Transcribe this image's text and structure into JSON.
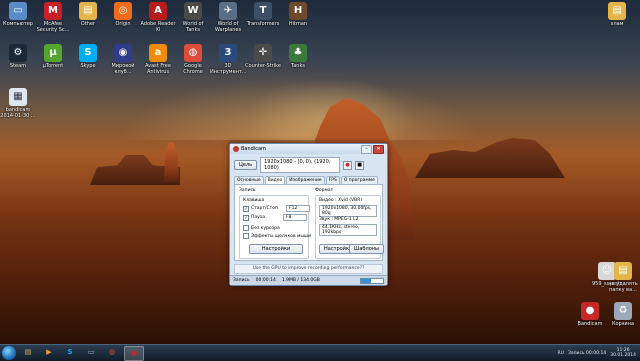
{
  "desktop_icons": [
    {
      "name": "computer",
      "label": "Компьютер",
      "color": "#5b8cc8",
      "glyph": "▭"
    },
    {
      "name": "mcafee",
      "label": "McAfee Security Sc...",
      "color": "#c8202a",
      "glyph": "M"
    },
    {
      "name": "other",
      "label": "Other",
      "color": "#e2b54a",
      "glyph": "▤"
    },
    {
      "name": "origin",
      "label": "Origin",
      "color": "#f26b1d",
      "glyph": "◎"
    },
    {
      "name": "acrobat",
      "label": "Adobe Reader XI",
      "color": "#b71c1c",
      "glyph": "A"
    },
    {
      "name": "wot",
      "label": "World of Tanks",
      "color": "#4a4a4a",
      "glyph": "W"
    },
    {
      "name": "wot-warplanes",
      "label": "World of Warplanes",
      "color": "#5a6f85",
      "glyph": "✈"
    },
    {
      "name": "transformers",
      "label": "Transformers",
      "color": "#3c4f66",
      "glyph": "T"
    },
    {
      "name": "shooter",
      "label": "Hitman",
      "color": "#6e4a2a",
      "glyph": "H"
    },
    {
      "name": "steam",
      "label": "Steam",
      "color": "#1b2838",
      "glyph": "⚙"
    },
    {
      "name": "utorrent",
      "label": "µTorrent",
      "color": "#55a630",
      "glyph": "µ"
    },
    {
      "name": "skype",
      "label": "Skype",
      "color": "#00aff0",
      "glyph": "S"
    },
    {
      "name": "multiplayer",
      "label": "Мировой\nклуб...",
      "color": "#303b8c",
      "glyph": "◉"
    },
    {
      "name": "avast",
      "label": "Avast Free Antivirus",
      "color": "#f28b00",
      "glyph": "a"
    },
    {
      "name": "chrome",
      "label": "Google Chrome",
      "color": "#dd4b39",
      "glyph": "◍"
    },
    {
      "name": "3d-tools",
      "label": "3D Инструмент...",
      "color": "#2b4a7c",
      "glyph": "3"
    },
    {
      "name": "counter-strike",
      "label": "Counter-Strike",
      "color": "#4a4a4a",
      "glyph": "✛"
    },
    {
      "name": "leaf-app",
      "label": "Tanks",
      "color": "#3b7a3b",
      "glyph": "♣"
    },
    {
      "name": "bandicam-file",
      "label": "bandicam 2014-01-30 ...",
      "color": "#dde6f2",
      "glyph": "▦"
    }
  ],
  "right_icons": [
    {
      "name": "folder-top",
      "label": "хлам",
      "color": "#e2b54a",
      "glyph": "▤"
    },
    {
      "name": "user-file",
      "label": "959_superh...",
      "color": "#d8d8d8",
      "glyph": "☺"
    },
    {
      "name": "doc-file",
      "label": "не удалять папку ва...",
      "color": "#e2b54a",
      "glyph": "▤"
    },
    {
      "name": "bandicam-app",
      "label": "Bandicam",
      "color": "#c62828",
      "glyph": "●"
    },
    {
      "name": "recycle-bin",
      "label": "Корзина",
      "color": "#9aa8b8",
      "glyph": "♻"
    }
  ],
  "window": {
    "title": "Bandicam",
    "target_label": "Цель",
    "region": "1920x1080 - (0, 0), (1920, 1080)",
    "rec_button": "●",
    "stop_button": "■",
    "tabs": [
      "Основные",
      "Видео",
      "Изображение",
      "FPS",
      "О программе"
    ],
    "active_tab": 1,
    "record_section": "Запись",
    "hotkey_label": "Клавиша",
    "startstop_label": "Старт/Стоп",
    "startstop_key": "F12",
    "pause_label": "Пауза",
    "pause_key": "F8",
    "no_cursor": "Без курсора",
    "click_effects": "Эффекты щелчков мыши",
    "settings_btn": "Настройки",
    "format_section": "Формат",
    "video_info": "Видео : Xvid (VBR)",
    "video_detail": "1920x1080, 30.00fps, 80q",
    "audio_info": "Звук : MPEG-1 L2",
    "audio_detail": "44.1KHz, stereo, 192kbps",
    "settings_btn2": "Настройки",
    "templates_btn": "Шаблоны",
    "gpu_hint": "Use the GPU to improve recording performance??",
    "status_recording": "Запись",
    "status_time": "00:00:14",
    "status_size": "1.9MB / 134.0GB",
    "progress": 0.45
  },
  "taskbar": {
    "items": [
      {
        "name": "explorer",
        "glyph": "▤",
        "color": "#e2b54a"
      },
      {
        "name": "media",
        "glyph": "▶",
        "color": "#f0a030"
      },
      {
        "name": "skype",
        "glyph": "S",
        "color": "#00aff0"
      },
      {
        "name": "notes",
        "glyph": "▭",
        "color": "#9ec2e6"
      },
      {
        "name": "chrome",
        "glyph": "◍",
        "color": "#dd4b39"
      },
      {
        "name": "bandicam",
        "glyph": "●",
        "color": "#c62828"
      }
    ],
    "tray_lang": "RU",
    "tray_rec": "Запись 00:00:14",
    "time": "11:26",
    "date": "30.01.2014"
  }
}
